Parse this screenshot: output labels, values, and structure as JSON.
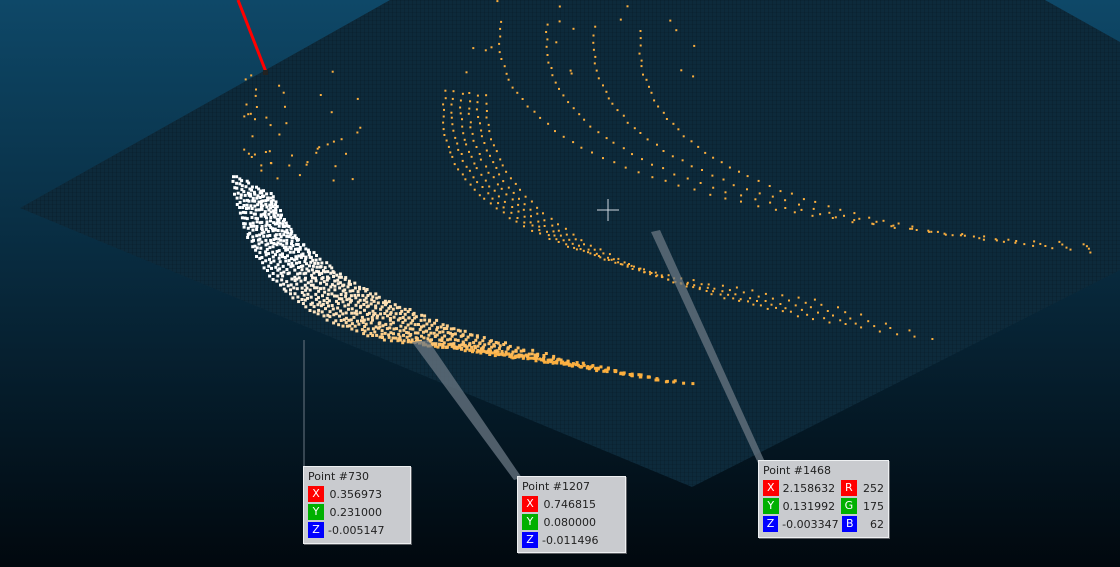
{
  "colors": {
    "background_top": "#0e4868",
    "background_bottom": "#01080e",
    "grid_plane": "#0d2a3b",
    "grid_lines": "#071924",
    "point_white": "#ffffff",
    "point_orange": "#fcaf3e",
    "axis_x": "#ff0000",
    "axis_y": "#00b000",
    "axis_z": "#0000ff",
    "label_box": "#c9cbcf",
    "leader_line": "#6a7783"
  },
  "labels": [
    {
      "title": "Point #730",
      "coords": [
        {
          "axis": "X",
          "value": "0.356973"
        },
        {
          "axis": "Y",
          "value": "0.231000"
        },
        {
          "axis": "Z",
          "value": "-0.005147"
        }
      ]
    },
    {
      "title": "Point #1207",
      "coords": [
        {
          "axis": "X",
          "value": "0.746815"
        },
        {
          "axis": "Y",
          "value": "0.080000"
        },
        {
          "axis": "Z",
          "value": "-0.011496"
        }
      ]
    },
    {
      "title": "Point #1468",
      "coords": [
        {
          "axis": "X",
          "value": "2.158632"
        },
        {
          "axis": "Y",
          "value": "0.131992"
        },
        {
          "axis": "Z",
          "value": "-0.003347"
        }
      ],
      "rgb": [
        {
          "channel": "R",
          "value": "252"
        },
        {
          "channel": "G",
          "value": "175"
        },
        {
          "channel": "B",
          "value": "62"
        }
      ]
    }
  ]
}
